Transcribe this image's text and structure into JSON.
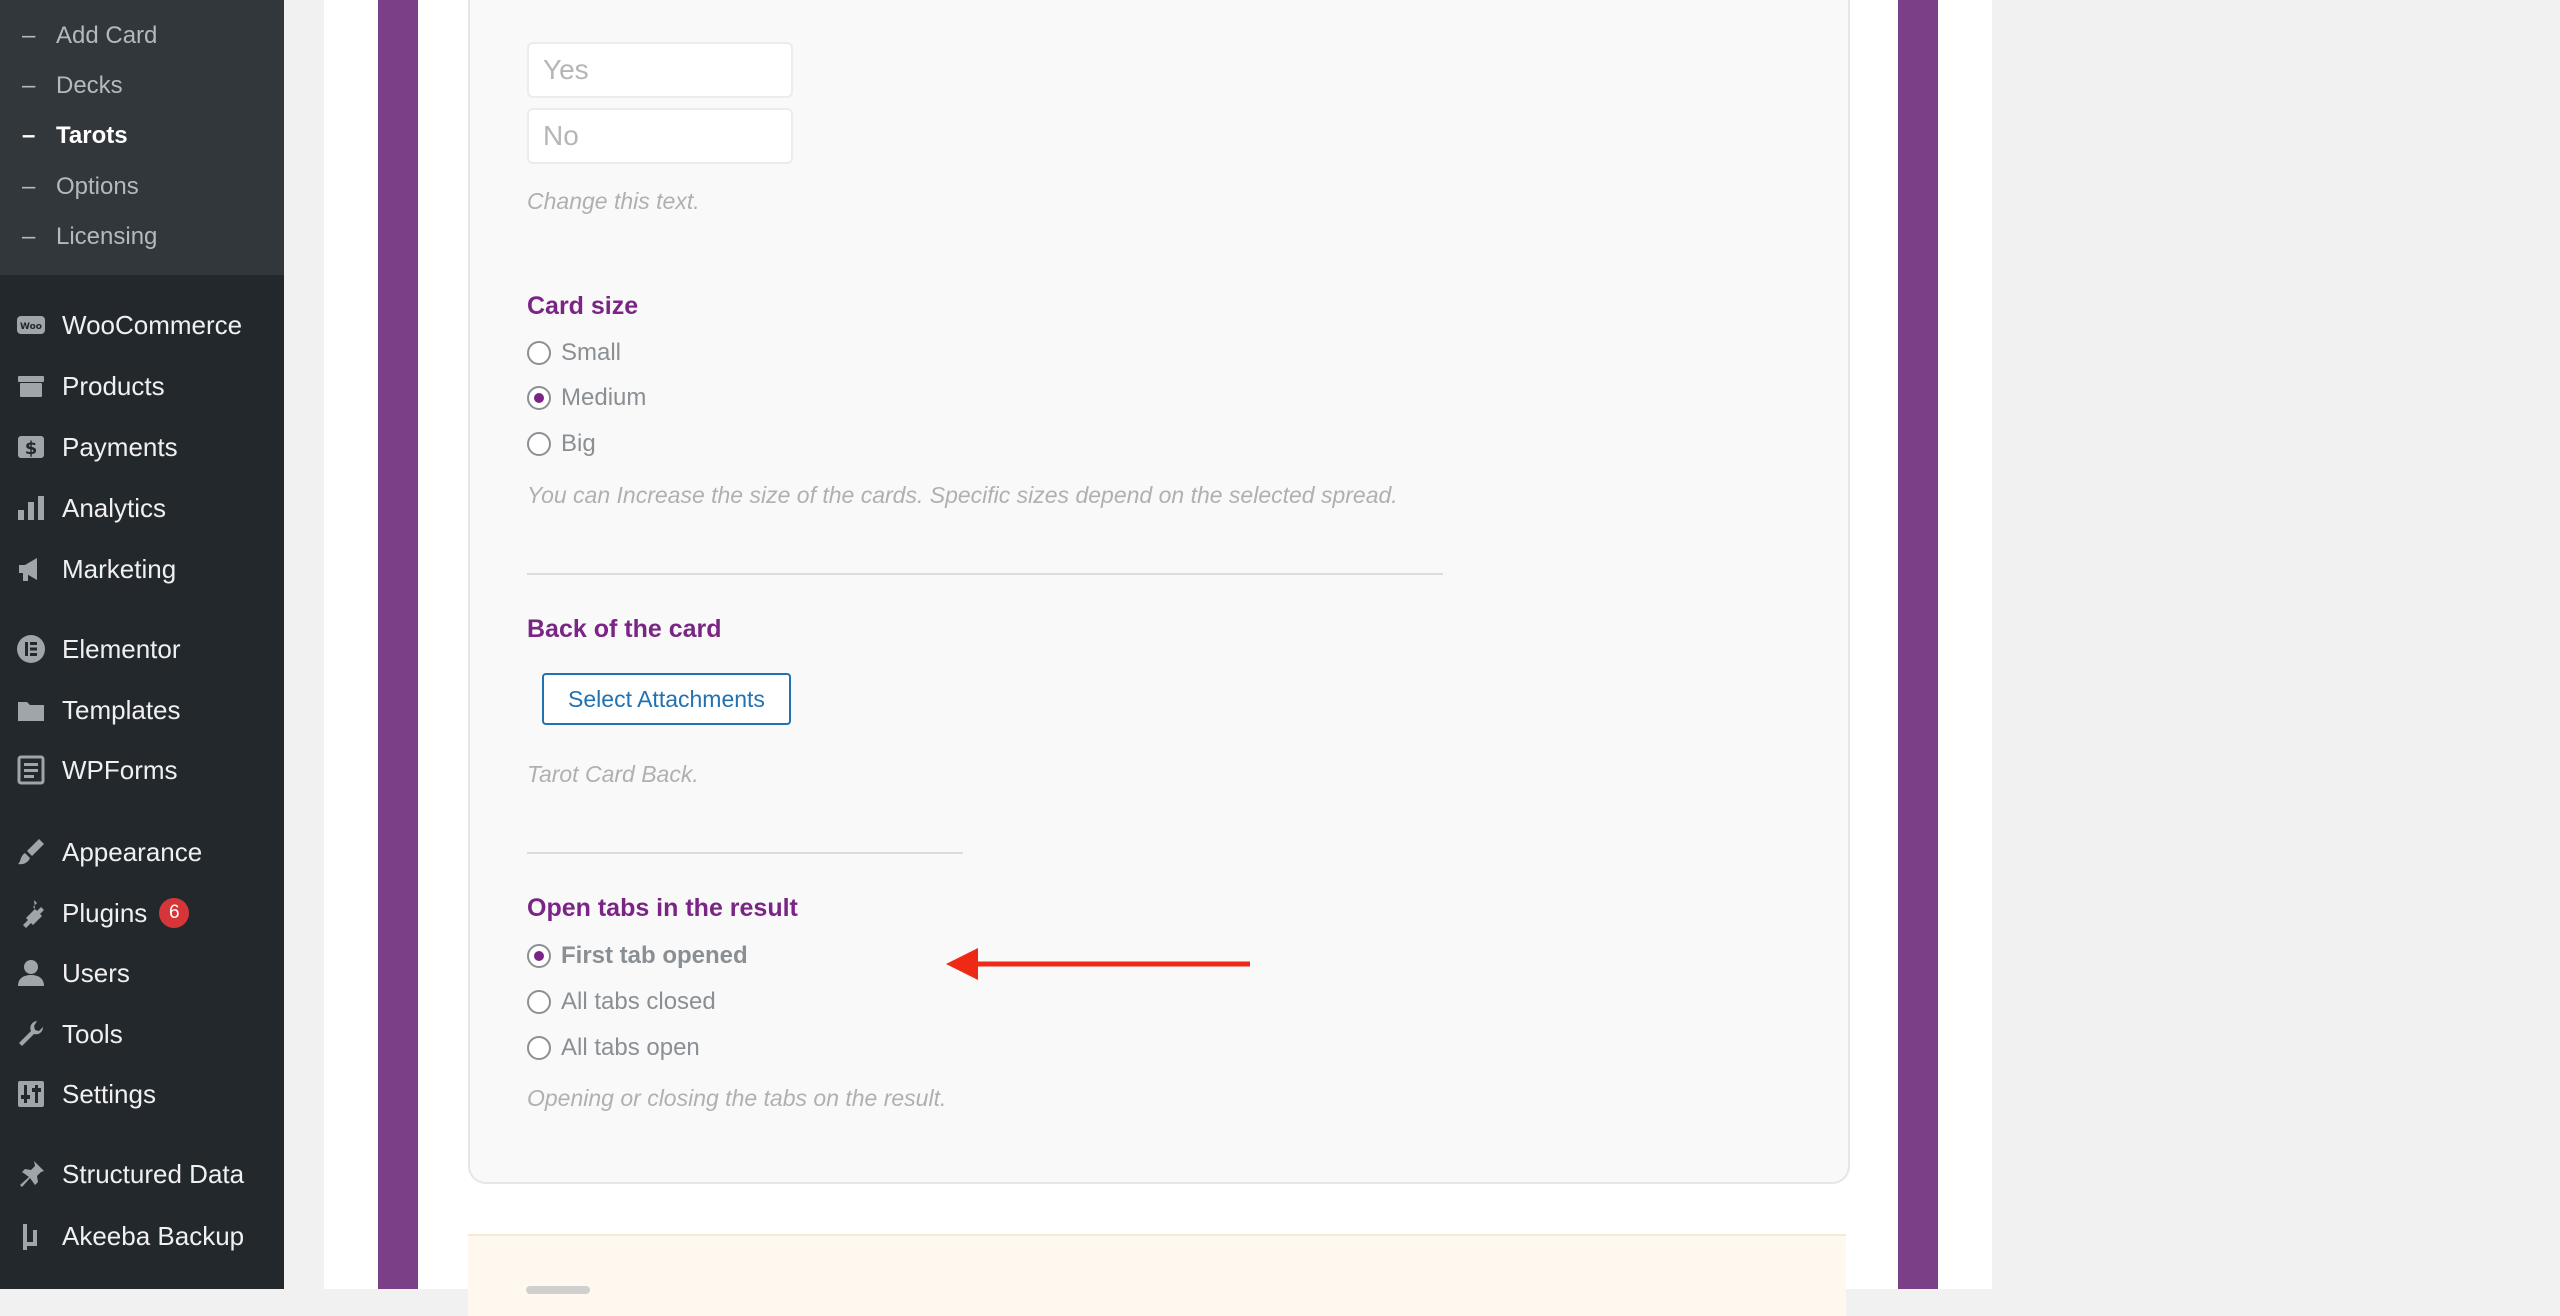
{
  "sidebar": {
    "submenu": [
      {
        "label": "Add Card",
        "active": false
      },
      {
        "label": "Decks",
        "active": false
      },
      {
        "label": "Tarots",
        "active": true
      },
      {
        "label": "Options",
        "active": false
      },
      {
        "label": "Licensing",
        "active": false
      }
    ],
    "menu": [
      {
        "label": "WooCommerce",
        "icon": "woocommerce-icon"
      },
      {
        "label": "Products",
        "icon": "archive-icon"
      },
      {
        "label": "Payments",
        "icon": "dollar-icon"
      },
      {
        "label": "Analytics",
        "icon": "bar-chart-icon"
      },
      {
        "label": "Marketing",
        "icon": "megaphone-icon"
      },
      {
        "label": "Elementor",
        "icon": "elementor-icon"
      },
      {
        "label": "Templates",
        "icon": "folder-icon"
      },
      {
        "label": "WPForms",
        "icon": "form-icon"
      },
      {
        "label": "Appearance",
        "icon": "paintbrush-icon"
      },
      {
        "label": "Plugins",
        "icon": "plug-icon",
        "badge": "6"
      },
      {
        "label": "Users",
        "icon": "user-icon"
      },
      {
        "label": "Tools",
        "icon": "wrench-icon"
      },
      {
        "label": "Settings",
        "icon": "sliders-icon"
      },
      {
        "label": "Structured Data",
        "icon": "pin-icon"
      },
      {
        "label": "Akeeba Backup",
        "icon": "akeeba-icon"
      }
    ]
  },
  "settings": {
    "yes_placeholder": "Yes",
    "no_placeholder": "No",
    "change_text_help": "Change this text.",
    "card_size": {
      "title": "Card size",
      "options": [
        "Small",
        "Medium",
        "Big"
      ],
      "selected": "Medium",
      "help": "You can Increase the size of the cards. Specific sizes depend on the selected spread."
    },
    "back_of_card": {
      "title": "Back of the card",
      "button": "Select Attachments",
      "help": "Tarot Card Back."
    },
    "open_tabs": {
      "title": "Open tabs in the result",
      "options": [
        "First tab opened",
        "All tabs closed",
        "All tabs open"
      ],
      "selected": "First tab opened",
      "help": "Opening or closing the tabs on the result."
    }
  },
  "colors": {
    "admin_sidebar": "#23282d",
    "accent_purple": "#7a2585",
    "annotation_arrow": "#ee2a16"
  }
}
